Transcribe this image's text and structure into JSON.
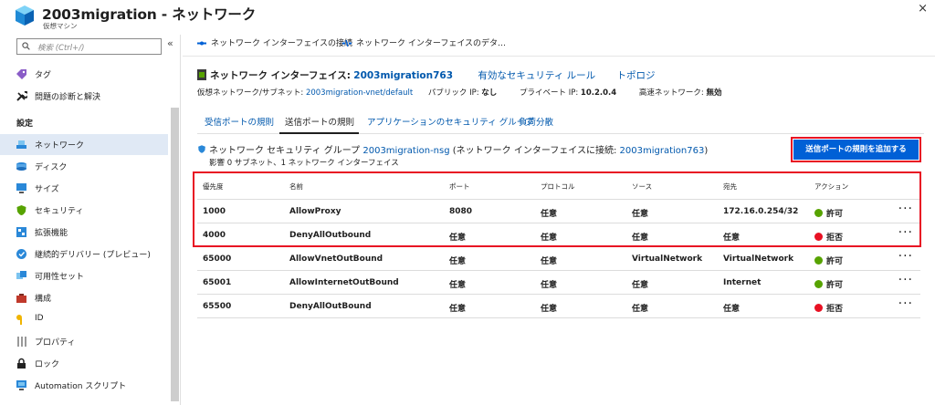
{
  "header": {
    "title": "2003migration - ネットワーク",
    "subtitle": "仮想マシン",
    "close_glyph": "×"
  },
  "sidebar": {
    "search_placeholder": "検索 (Ctrl+/)",
    "collapse_glyph": "«",
    "section_settings": "設定",
    "items_top": [
      {
        "label": "タグ",
        "icon": "tag-icon"
      },
      {
        "label": "問題の診断と解決",
        "icon": "wrench-icon"
      }
    ],
    "items": [
      {
        "label": "ネットワーク",
        "icon": "network-icon",
        "selected": true
      },
      {
        "label": "ディスク",
        "icon": "disk-icon"
      },
      {
        "label": "サイズ",
        "icon": "monitor-icon"
      },
      {
        "label": "セキュリティ",
        "icon": "shield-icon"
      },
      {
        "label": "拡張機能",
        "icon": "extension-icon"
      },
      {
        "label": "継続的デリバリー (プレビュー)",
        "icon": "delivery-icon"
      },
      {
        "label": "可用性セット",
        "icon": "availability-icon"
      },
      {
        "label": "構成",
        "icon": "toolbox-icon"
      },
      {
        "label": "ID",
        "icon": "key-icon"
      },
      {
        "label": "プロパティ",
        "icon": "properties-icon"
      },
      {
        "label": "ロック",
        "icon": "lock-icon"
      },
      {
        "label": "Automation スクリプト",
        "icon": "script-icon"
      }
    ]
  },
  "toolbar": {
    "attach_label": "ネットワーク インターフェイスの接続",
    "detach_label": "ネットワーク インターフェイスのデタ…"
  },
  "nic": {
    "label": "ネットワーク インターフェイス:",
    "name": "2003migration763",
    "effective_rules": "有効なセキュリティ ルール",
    "topology": "トポロジ",
    "vnet_label": "仮想ネットワーク/サブネット:",
    "vnet_value": "2003migration-vnet/default",
    "public_ip_label": "パブリック IP:",
    "public_ip_value": "なし",
    "private_ip_label": "プライベート IP:",
    "private_ip_value": "10.2.0.4",
    "accel_label": "高速ネットワーク:",
    "accel_value": "無効"
  },
  "tabs": [
    "受信ポートの規則",
    "送信ポートの規則",
    "アプリケーションのセキュリティ グループ",
    "負荷分散"
  ],
  "nsg": {
    "prefix": "ネットワーク セキュリティ グループ",
    "name": "2003migration-nsg",
    "mid": "(ネットワーク インターフェイスに接続:",
    "nic": "2003migration763",
    "suffix": ")",
    "impact": "影響 0 サブネット、1 ネットワーク インターフェイス",
    "add_button": "送信ポートの規則を追加する"
  },
  "table": {
    "headers": [
      "優先度",
      "名前",
      "ポート",
      "プロトコル",
      "ソース",
      "宛先",
      "アクション"
    ],
    "rows": [
      {
        "priority": "1000",
        "name": "AllowProxy",
        "port": "8080",
        "protocol": "任意",
        "source": "任意",
        "dest": "172.16.0.254/32",
        "action": "許可",
        "allow": true
      },
      {
        "priority": "4000",
        "name": "DenyAllOutbound",
        "port": "任意",
        "protocol": "任意",
        "source": "任意",
        "dest": "任意",
        "action": "拒否",
        "allow": false
      },
      {
        "priority": "65000",
        "name": "AllowVnetOutBound",
        "port": "任意",
        "protocol": "任意",
        "source": "VirtualNetwork",
        "dest": "VirtualNetwork",
        "action": "許可",
        "allow": true
      },
      {
        "priority": "65001",
        "name": "AllowInternetOutBound",
        "port": "任意",
        "protocol": "任意",
        "source": "任意",
        "dest": "Internet",
        "action": "許可",
        "allow": true
      },
      {
        "priority": "65500",
        "name": "DenyAllOutBound",
        "port": "任意",
        "protocol": "任意",
        "source": "任意",
        "dest": "任意",
        "action": "拒否",
        "allow": false
      }
    ],
    "more_glyph": "···"
  },
  "colors": {
    "allow": "#57a300",
    "deny": "#e81123",
    "link": "#0058ad",
    "accent": "#0060d6"
  }
}
